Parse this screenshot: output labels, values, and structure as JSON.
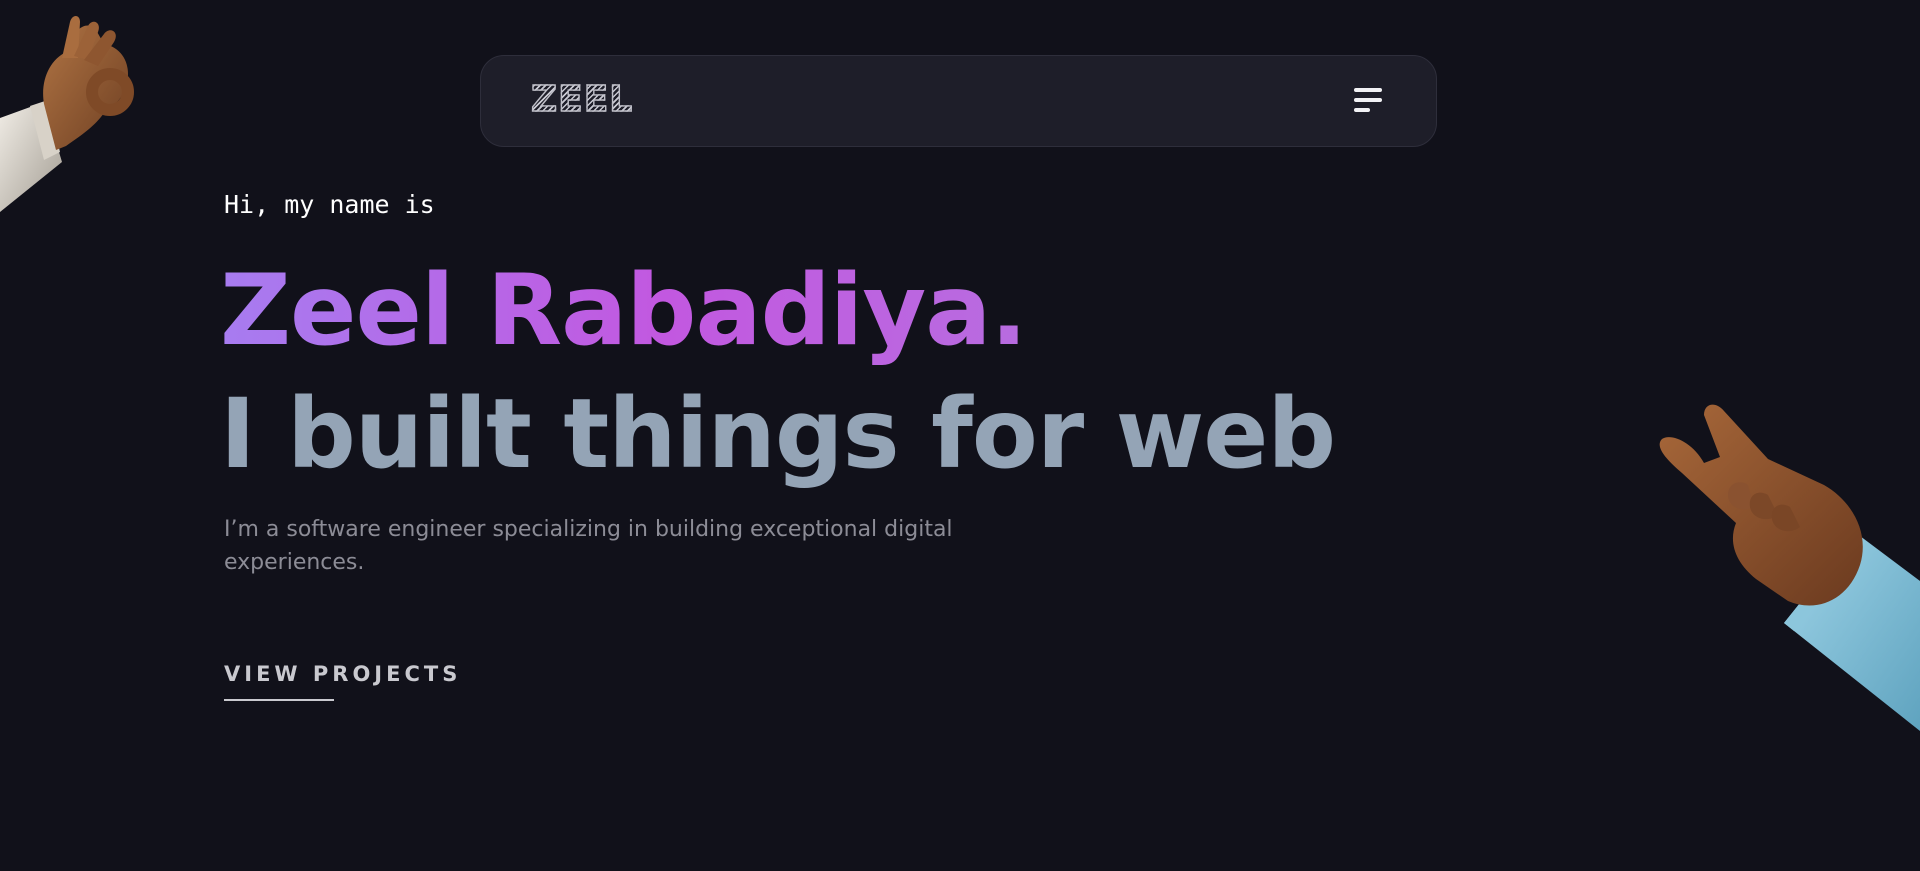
{
  "navbar": {
    "logo": "ZEEL",
    "menu_icon": "hamburger-menu-icon"
  },
  "hero": {
    "greeting": "Hi, my name is",
    "name": "Zeel Rabadiya.",
    "tagline": "I built things for web",
    "description": "I’m a software engineer specializing in building exceptional digital experiences.",
    "cta_label": "VIEW PROJECTS"
  },
  "decor": {
    "left_hand": "ok-hand-emoji",
    "right_hand": "rock-on-hand-emoji"
  },
  "colors": {
    "background": "#11111a",
    "navbar": "#1e1e29",
    "name_gradient_start": "#a77cf0",
    "name_gradient_end": "#c258e0",
    "tagline": "#94a4b6",
    "body_text": "#8c8c96"
  }
}
